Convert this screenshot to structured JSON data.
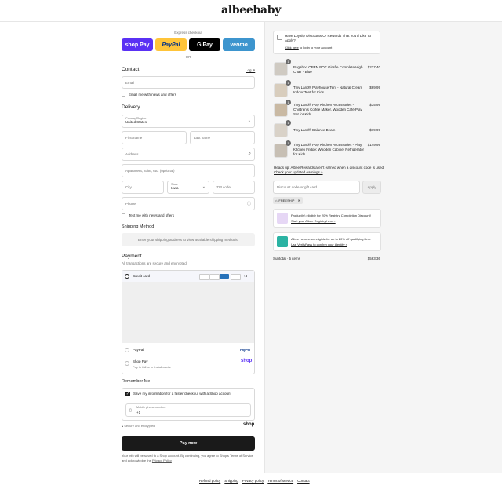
{
  "brand": {
    "logo_text": "albeebaby"
  },
  "express": {
    "label": "Express checkout",
    "buttons": [
      {
        "label": "shop Pay",
        "bg": "#5a31f4",
        "fg": "#ffffff"
      },
      {
        "label": "PayPal",
        "bg": "#ffc439",
        "fg": "#003087"
      },
      {
        "label": "G Pay",
        "bg": "#000000",
        "fg": "#ffffff"
      },
      {
        "label": "venmo",
        "bg": "#3d95ce",
        "fg": "#ffffff"
      }
    ],
    "or": "OR"
  },
  "contact": {
    "title": "Contact",
    "login": "Log in",
    "email_placeholder": "Email",
    "news_label": "Email me with news and offers"
  },
  "delivery": {
    "title": "Delivery",
    "country_label": "Country/Region",
    "country_value": "United States",
    "first_name": "First name",
    "last_name": "Last name",
    "address": "Address",
    "apartment": "Apartment, suite, etc. (optional)",
    "city": "City",
    "state_label": "State",
    "state_value": "Iowa",
    "zip": "ZIP code",
    "phone": "Phone",
    "text_label": "Text me with news and offers"
  },
  "shipping": {
    "title": "Shipping Method",
    "note": "Enter your shipping address to view available shipping methods."
  },
  "payment": {
    "title": "Payment",
    "subtitle": "All transactions are secure and encrypted.",
    "credit_card": "Credit card",
    "card_more": "+4",
    "paypal": "PayPal",
    "paypal_logo": "PayPal",
    "shop_pay": "Shop Pay",
    "shop_pay_sub": "Pay in full or in installments",
    "shop_logo": "shop"
  },
  "remember": {
    "title": "Remember Me",
    "save_label": "Save my information for a faster checkout with a Shop account",
    "mobile_label": "Mobile phone number",
    "mobile_value": "+1",
    "secure": "Secure and encrypted",
    "shop_logo": "shop"
  },
  "pay_now": "Pay now",
  "disclaimer": {
    "text": "Your info will be saved to a Shop account. By continuing, you agree to Shop's",
    "terms": "Terms of Service",
    "and": "and acknowledge the",
    "privacy": "Privacy Policy"
  },
  "loyalty": {
    "title": "Have Loyalty Discounts Or Rewards That You'd Like To Apply?",
    "link": "Click here",
    "link_rest": "to login to your account"
  },
  "cart": {
    "items": [
      {
        "qty": "1",
        "name": "Bugaboo OPEN BOX Giraffe Complete High Chair - Blue",
        "price": "$227.40",
        "color": "#cfcac2"
      },
      {
        "qty": "1",
        "name": "Tiny Land® Playhouse Tent - Natural Cream Indoor Tent for Kids",
        "price": "$69.99",
        "color": "#d8cdbd"
      },
      {
        "qty": "1",
        "name": "Tiny Land® Play Kitchen Accessories - Children's Coffee Maker, Wooden Café Play Set for Kids",
        "price": "$35.99",
        "color": "#c9b9a3"
      },
      {
        "qty": "1",
        "name": "Tiny Land® Balance Beam",
        "price": "$79.99",
        "color": "#d9d2c8"
      },
      {
        "qty": "1",
        "name": "Tiny Land® Play Kitchen Accessories - Play Kitchen Fridge: Wooden Cabinet Refrigerator for Kids",
        "price": "$149.99",
        "color": "#c7bfb4"
      }
    ],
    "rewards_note": "Heads up: Albee Rewards aren't earned when a discount code is used.",
    "rewards_link": "Check your updated earnings »",
    "discount_placeholder": "Discount code or gift card",
    "apply": "Apply",
    "tag": "FREESHIP",
    "registry_text": "Product(s) eligible for 20% Registry Completion Discount!",
    "registry_link": "Start your Albee Registry here »",
    "heroes_text": "Albee heroes are eligible for up to 20% off qualifying item.",
    "heroes_link": "Use VerifyPass to confirm your identity »",
    "subtotal_label": "Subtotal · 5 items",
    "subtotal_value": "$563.36"
  },
  "footer": {
    "links": [
      "Refund policy",
      "Shipping",
      "Privacy policy",
      "Terms of service",
      "Contact"
    ]
  }
}
